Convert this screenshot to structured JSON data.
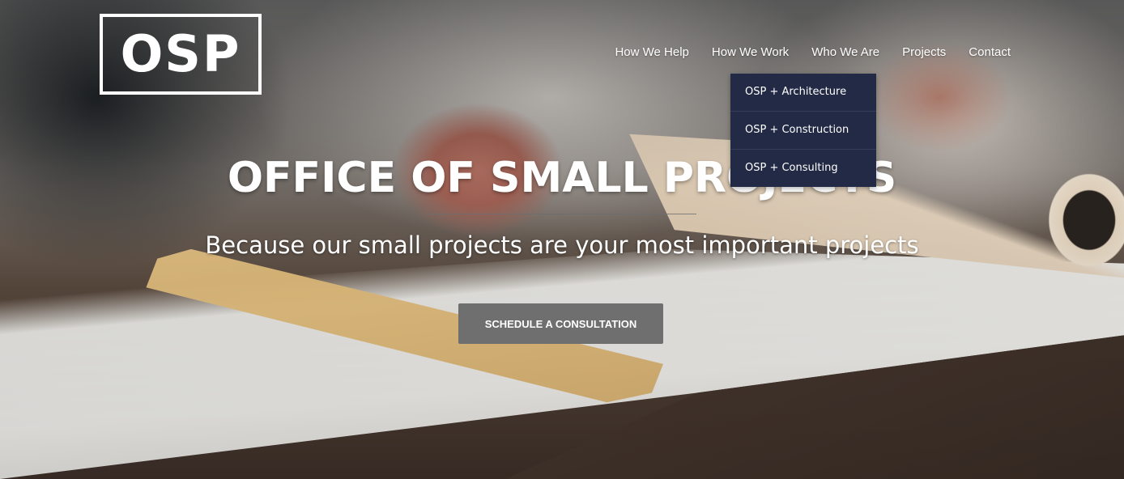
{
  "logo": {
    "text": "OSP"
  },
  "nav": {
    "items": [
      {
        "label": "How We Help"
      },
      {
        "label": "How We Work"
      },
      {
        "label": "Who We Are"
      },
      {
        "label": "Projects"
      },
      {
        "label": "Contact"
      }
    ]
  },
  "dropdown": {
    "items": [
      {
        "label": "OSP + Architecture"
      },
      {
        "label": "OSP + Construction"
      },
      {
        "label": "OSP + Consulting"
      }
    ]
  },
  "hero": {
    "headline": "OFFICE OF SMALL PROJECTS",
    "tagline": "Because our small projects are your most important projects",
    "cta_label": "SCHEDULE A CONSULTATION"
  },
  "colors": {
    "dropdown_bg": "#232a45",
    "cta_bg": "#6f6f6f",
    "text": "#ffffff"
  }
}
